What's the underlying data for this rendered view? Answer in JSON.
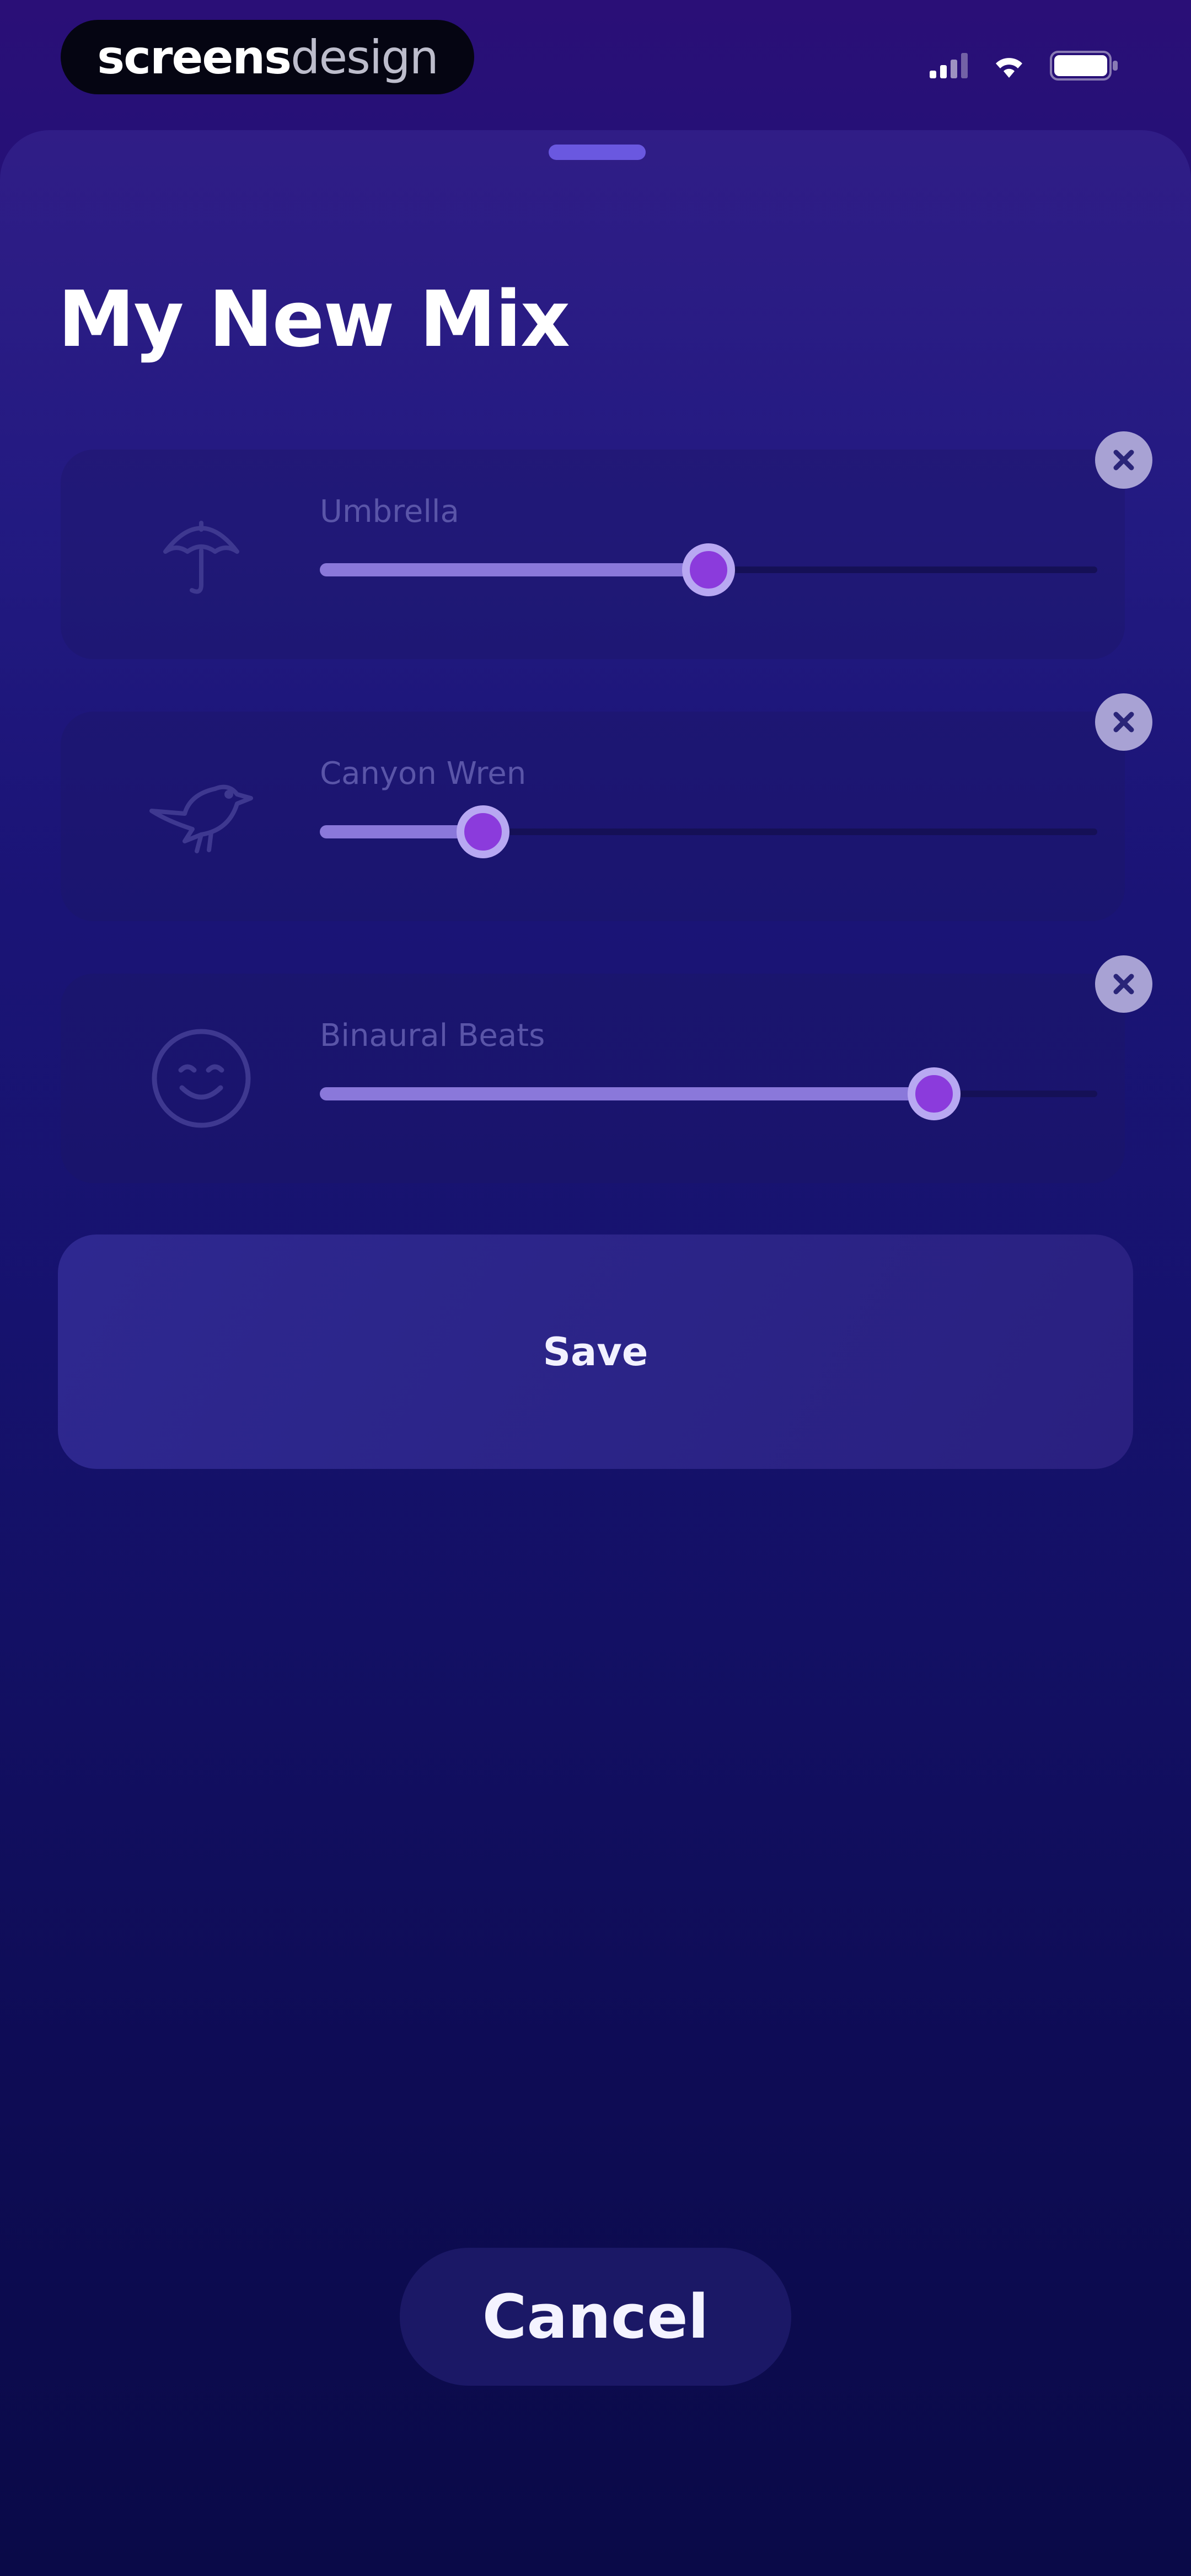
{
  "status_bar": {
    "brand_strong": "screens",
    "brand_light": "design"
  },
  "sheet": {
    "title": "My New Mix"
  },
  "sounds": [
    {
      "label": "Umbrella",
      "icon": "umbrella-icon",
      "level": 0.5
    },
    {
      "label": "Canyon Wren",
      "icon": "bird-icon",
      "level": 0.21
    },
    {
      "label": "Binaural Beats",
      "icon": "face-icon",
      "level": 0.79
    }
  ],
  "actions": {
    "save_label": "Save",
    "cancel_label": "Cancel"
  },
  "colors": {
    "accent": "#8b3bdc",
    "slider_fill": "#8a78da",
    "background_top": "#2a0f77",
    "background_bottom": "#0a0a48"
  }
}
